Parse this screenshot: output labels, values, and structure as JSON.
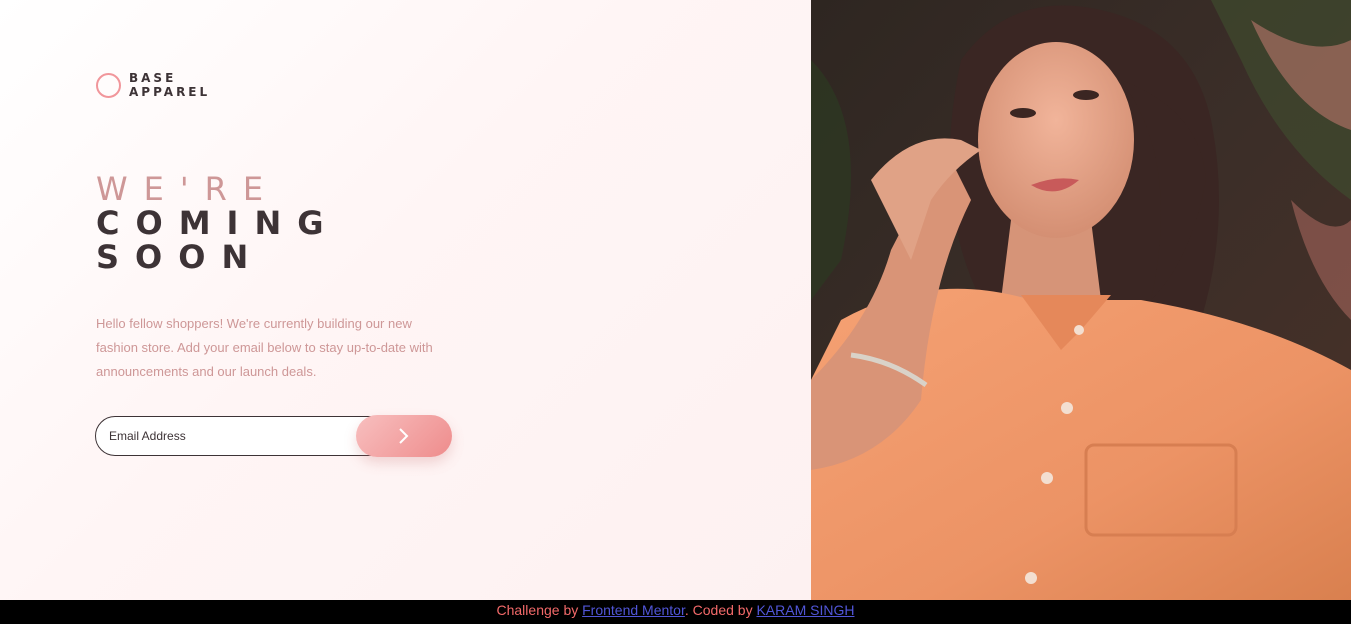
{
  "brand": {
    "line1": "BASE",
    "line2": "APPAREL"
  },
  "headline": {
    "light": "WE'RE",
    "line2": "COMING",
    "line3": "SOON"
  },
  "description": "Hello fellow shoppers! We're currently building our new fashion store. Add your email below to stay up-to-date with announcements and our launch deals.",
  "form": {
    "email_placeholder": "Email Address",
    "submit_icon": "chevron-right-icon"
  },
  "hero": {
    "image": "woman-in-orange-shirt-photo"
  },
  "footer": {
    "prefix": "Challenge by ",
    "link1": "Frontend Mentor",
    "middle": ". Coded by ",
    "link2": "KARAM SINGH"
  },
  "colors": {
    "accent": "#ce9797",
    "dark": "#3d3336",
    "gradient_start": "#f8bfbf",
    "gradient_end": "#ee8c8c",
    "footer_text": "#f36a6a",
    "footer_link": "#5156d8"
  }
}
